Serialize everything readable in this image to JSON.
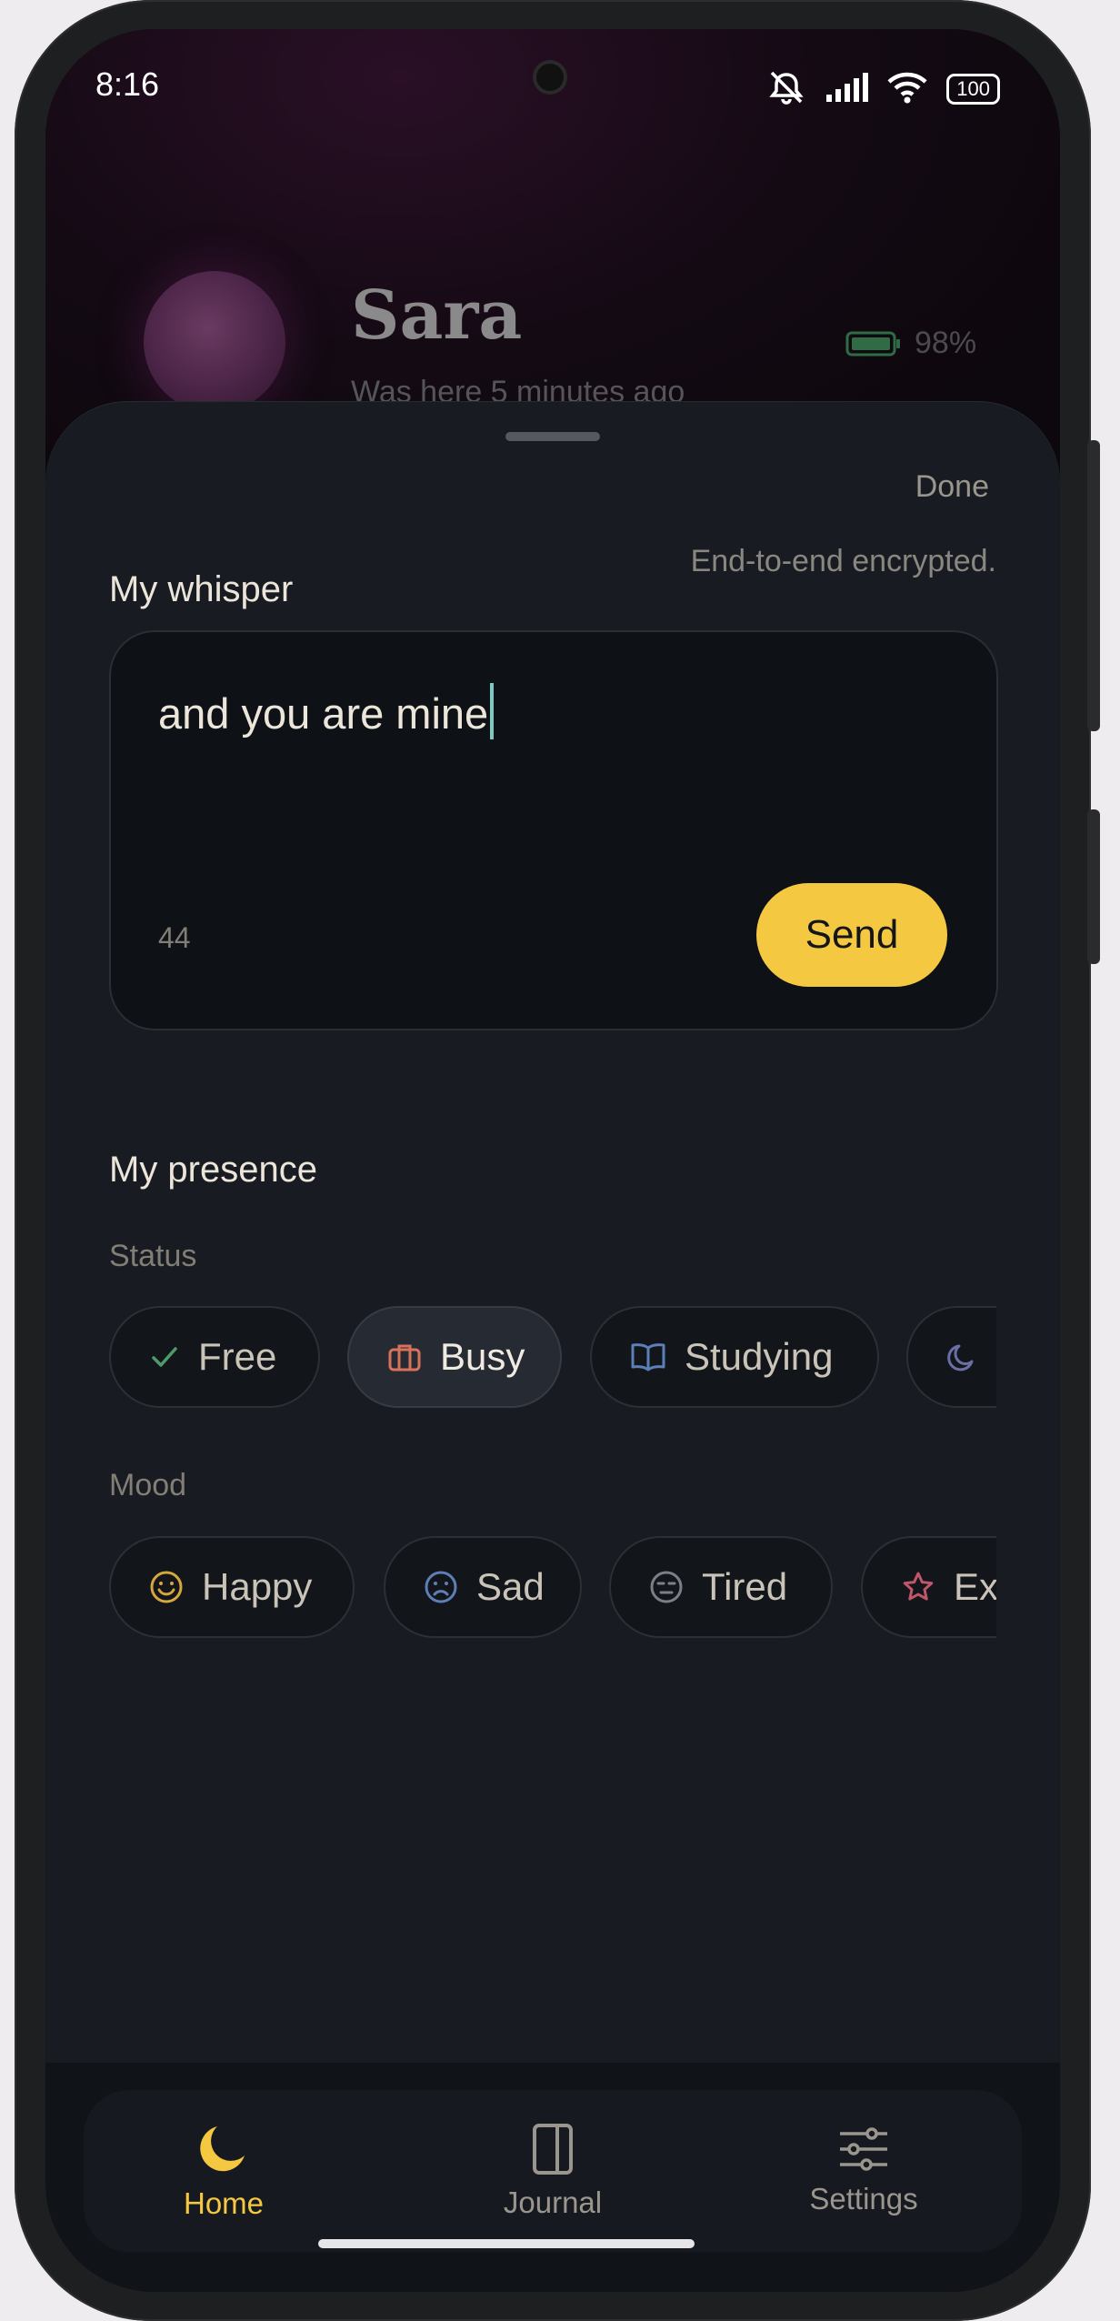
{
  "status_bar": {
    "time": "8:16",
    "battery": "100"
  },
  "partner": {
    "name": "Sara",
    "last_seen": "Was here 5 minutes ago",
    "battery": "98%"
  },
  "sheet": {
    "done_label": "Done",
    "whisper": {
      "title": "My whisper",
      "encryption_note": "End-to-end encrypted.",
      "message": "and you are mine",
      "remaining_chars": "44",
      "send_label": "Send"
    },
    "presence": {
      "title": "My presence",
      "status_label": "Status",
      "status_options": [
        {
          "label": "Free",
          "icon": "check-icon",
          "selected": false
        },
        {
          "label": "Busy",
          "icon": "briefcase-icon",
          "selected": true
        },
        {
          "label": "Studying",
          "icon": "book-icon",
          "selected": false
        },
        {
          "label": "",
          "icon": "moon-icon",
          "selected": false
        }
      ],
      "mood_label": "Mood",
      "mood_options": [
        {
          "label": "Happy",
          "icon": "smile-icon"
        },
        {
          "label": "Sad",
          "icon": "frown-icon"
        },
        {
          "label": "Tired",
          "icon": "tired-face-icon"
        },
        {
          "label": "Exc",
          "icon": "star-icon"
        }
      ]
    }
  },
  "tabs": [
    {
      "label": "Home",
      "icon": "moon-icon",
      "active": true
    },
    {
      "label": "Journal",
      "icon": "journal-icon",
      "active": false
    },
    {
      "label": "Settings",
      "icon": "sliders-icon",
      "active": false
    }
  ],
  "colors": {
    "accent": "#f5c842",
    "caret": "#7cc9c2",
    "sheet_bg": "#181b21"
  }
}
